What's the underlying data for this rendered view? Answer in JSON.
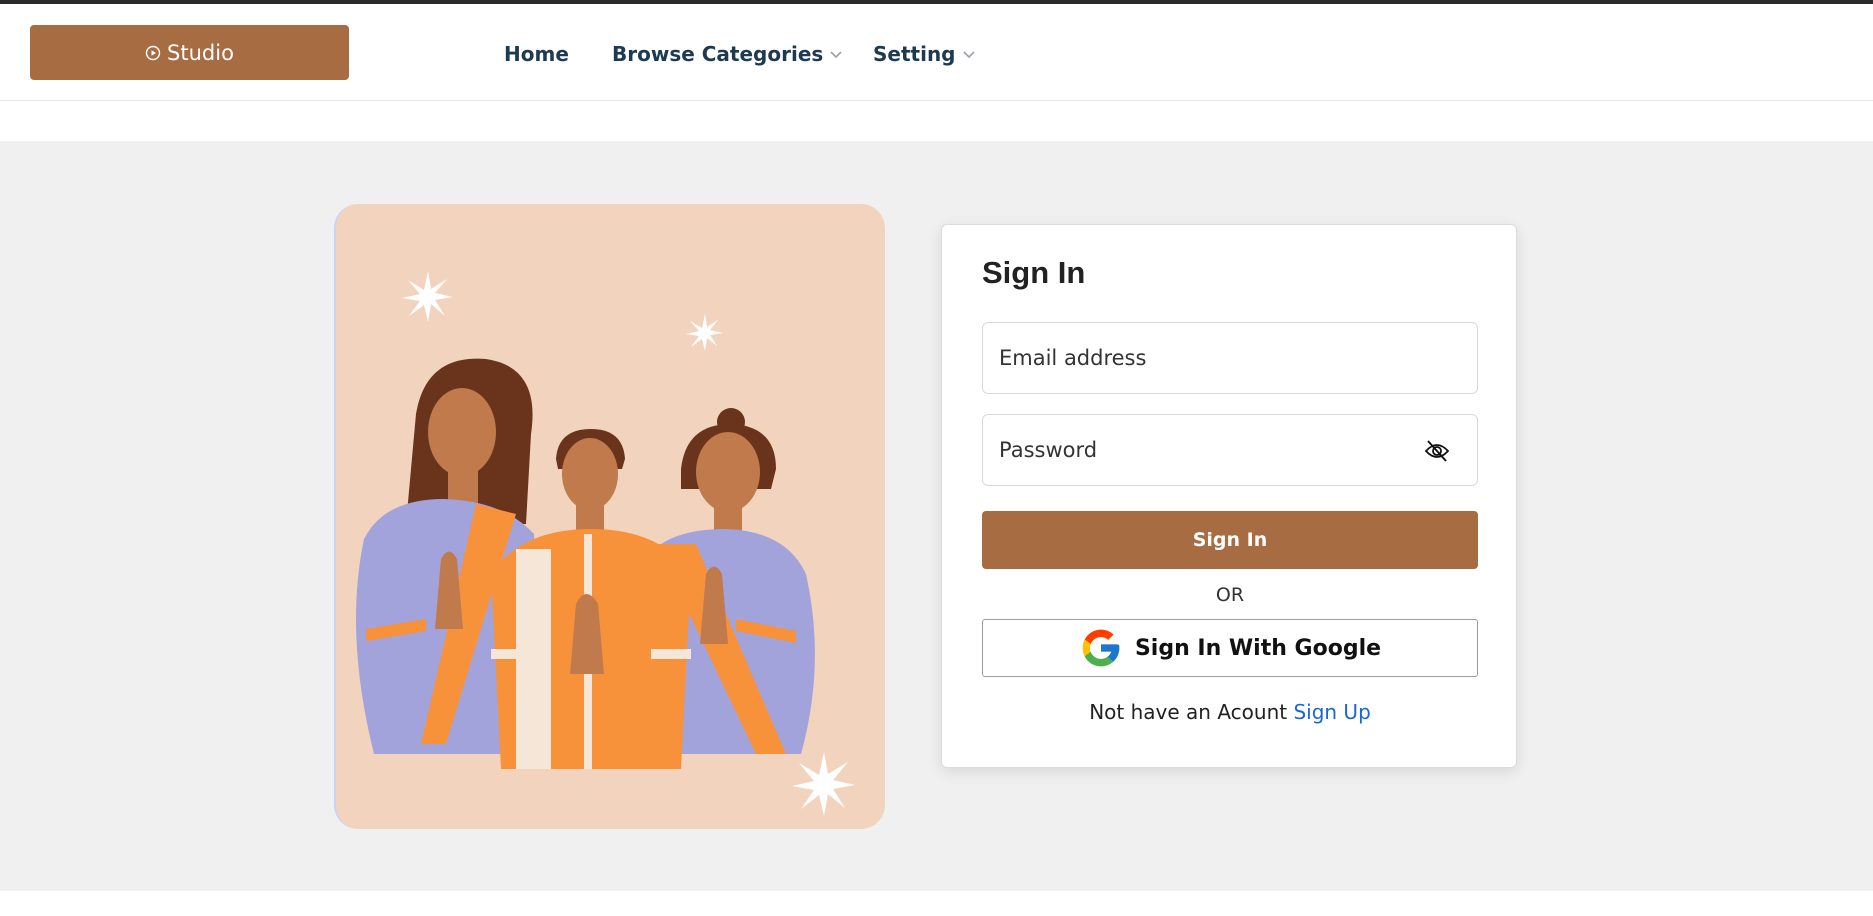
{
  "nav": {
    "brand_label": "Studio",
    "links": [
      {
        "label": "Home",
        "has_dropdown": false
      },
      {
        "label": "Browse Categories",
        "has_dropdown": true
      },
      {
        "label": "Setting",
        "has_dropdown": true
      }
    ]
  },
  "signin": {
    "title": "Sign In",
    "email_placeholder": "Email address",
    "password_placeholder": "Password",
    "submit_label": "Sign In",
    "or_text": "OR",
    "google_label": "Sign In With Google",
    "no_account_text": "Not have an Acount",
    "signup_link": "Sign Up"
  },
  "colors": {
    "brand": "#a86c42",
    "page_background": "#f0f0f0",
    "illustration_background": "#f2d4be",
    "link": "#1a66d9"
  },
  "icons": {
    "brand": "play-circle-icon",
    "dropdown": "chevron-down-icon",
    "password_toggle": "eye-off-icon",
    "google": "google-logo-icon"
  }
}
